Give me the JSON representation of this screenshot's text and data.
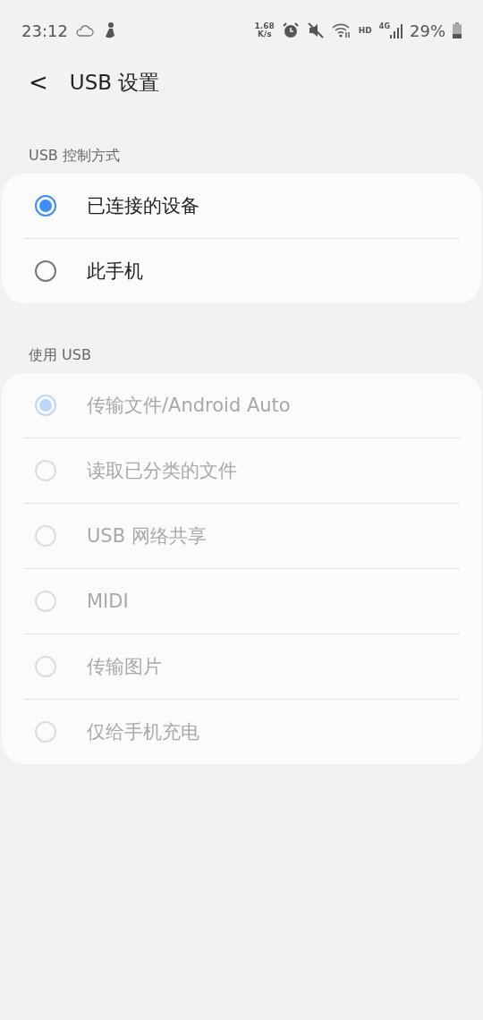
{
  "status_bar": {
    "time": "23:12",
    "speed_value": "1.68",
    "speed_unit": "K/s",
    "hd": "HD",
    "network": "4G",
    "battery": "29%"
  },
  "header": {
    "back": "<",
    "title": "USB 设置"
  },
  "sections": [
    {
      "title": "USB 控制方式",
      "disabled": false,
      "options": [
        {
          "label": "已连接的设备",
          "selected": true
        },
        {
          "label": "此手机",
          "selected": false
        }
      ]
    },
    {
      "title": "使用 USB",
      "disabled": true,
      "options": [
        {
          "label": "传输文件/Android Auto",
          "selected": true
        },
        {
          "label": "读取已分类的文件",
          "selected": false
        },
        {
          "label": "USB 网络共享",
          "selected": false
        },
        {
          "label": "MIDI",
          "selected": false
        },
        {
          "label": "传输图片",
          "selected": false
        },
        {
          "label": "仅给手机充电",
          "selected": false
        }
      ]
    }
  ]
}
